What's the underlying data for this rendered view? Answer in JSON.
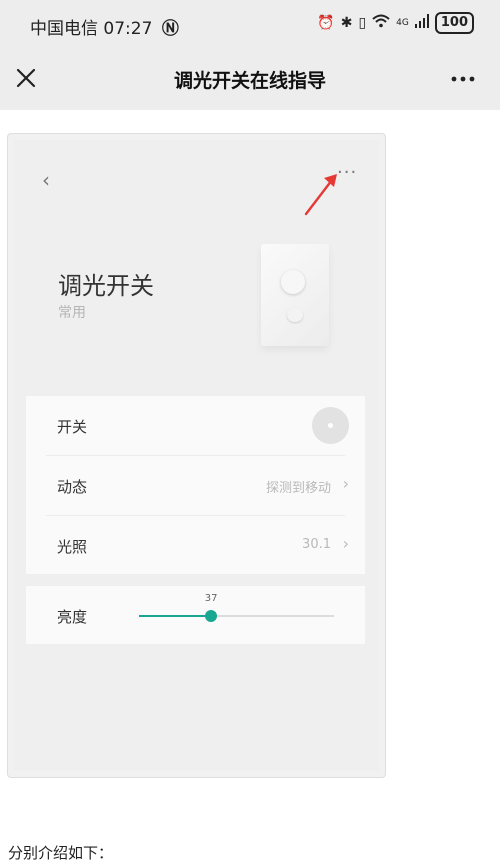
{
  "status_bar": {
    "carrier": "中国电信",
    "time": "07:27",
    "signal": "4G",
    "battery": "100"
  },
  "header": {
    "title": "调光开关在线指导"
  },
  "screenshot": {
    "device": {
      "name": "调光开关",
      "room": "常用"
    },
    "rows": [
      {
        "label": "开关",
        "value": ""
      },
      {
        "label": "动态",
        "value": "探测到移动"
      },
      {
        "label": "光照",
        "value": "30.1"
      }
    ],
    "brightness": {
      "label": "亮度",
      "value": "37",
      "level": 0.37
    },
    "accent_color": "#19a792",
    "annotation_color": "#e53935"
  },
  "article": {
    "caption": "分别介绍如下："
  }
}
